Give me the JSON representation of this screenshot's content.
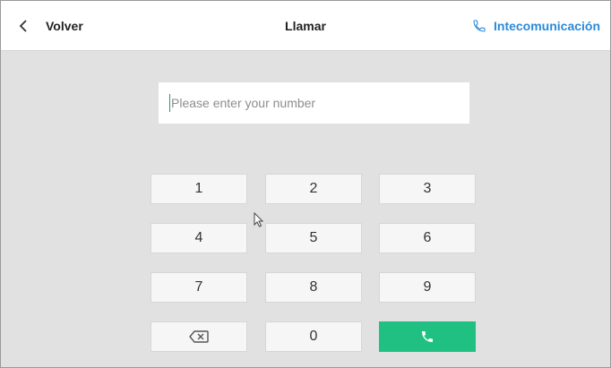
{
  "header": {
    "back_label": "Volver",
    "title": "Llamar",
    "intercom_label": "Intecomunicación"
  },
  "input": {
    "placeholder": "Please enter your number",
    "value": ""
  },
  "keypad": {
    "keys": [
      "1",
      "2",
      "3",
      "4",
      "5",
      "6",
      "7",
      "8",
      "9",
      "0"
    ],
    "backspace_icon": "backspace-icon",
    "call_icon": "phone-icon"
  },
  "colors": {
    "call_button": "#20c083",
    "intercom_accent": "#2b8ad8",
    "background": "#e1e1e1"
  }
}
